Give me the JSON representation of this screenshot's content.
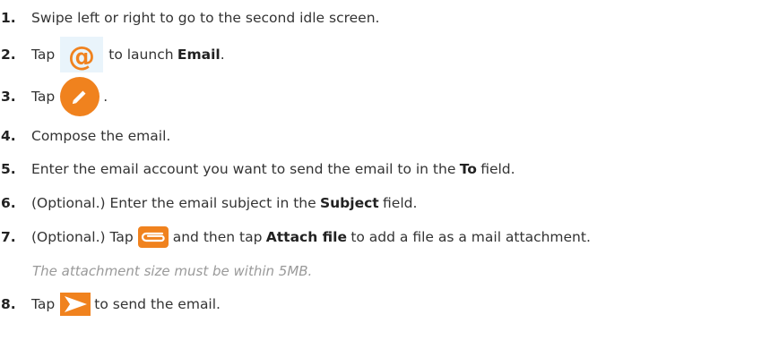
{
  "steps": [
    {
      "num": "1.",
      "text": "Swipe left or right to go to the second idle screen."
    },
    {
      "num": "2.",
      "pre": "Tap",
      "post": "to launch",
      "bold": "Email",
      "end": "."
    },
    {
      "num": "3.",
      "pre": "Tap",
      "end": "."
    },
    {
      "num": "4.",
      "text": "Compose the email."
    },
    {
      "num": "5.",
      "pre": "Enter the email account you want to send the email to in the",
      "bold": "To",
      "post": "field."
    },
    {
      "num": "6.",
      "pre": "(Optional.) Enter the email subject in the",
      "bold": "Subject",
      "post": "field."
    },
    {
      "num": "7.",
      "pre": "(Optional.) Tap",
      "mid": "and then tap",
      "bold": "Attach file",
      "post": "to add a file as a mail attachment.",
      "note": "The attachment size must be within 5MB."
    },
    {
      "num": "8.",
      "pre": "Tap",
      "post": "to send the email."
    }
  ],
  "icons": {
    "email_app": "at-sign-icon",
    "compose": "pencil-icon",
    "attachment": "paperclip-icon",
    "send": "send-arrow-icon"
  },
  "colors": {
    "accent_orange": "#f0821e",
    "email_blue": "#e9f4fb",
    "number_text": "#222222",
    "body_text": "#333333",
    "note_text": "#9a9a9a"
  }
}
